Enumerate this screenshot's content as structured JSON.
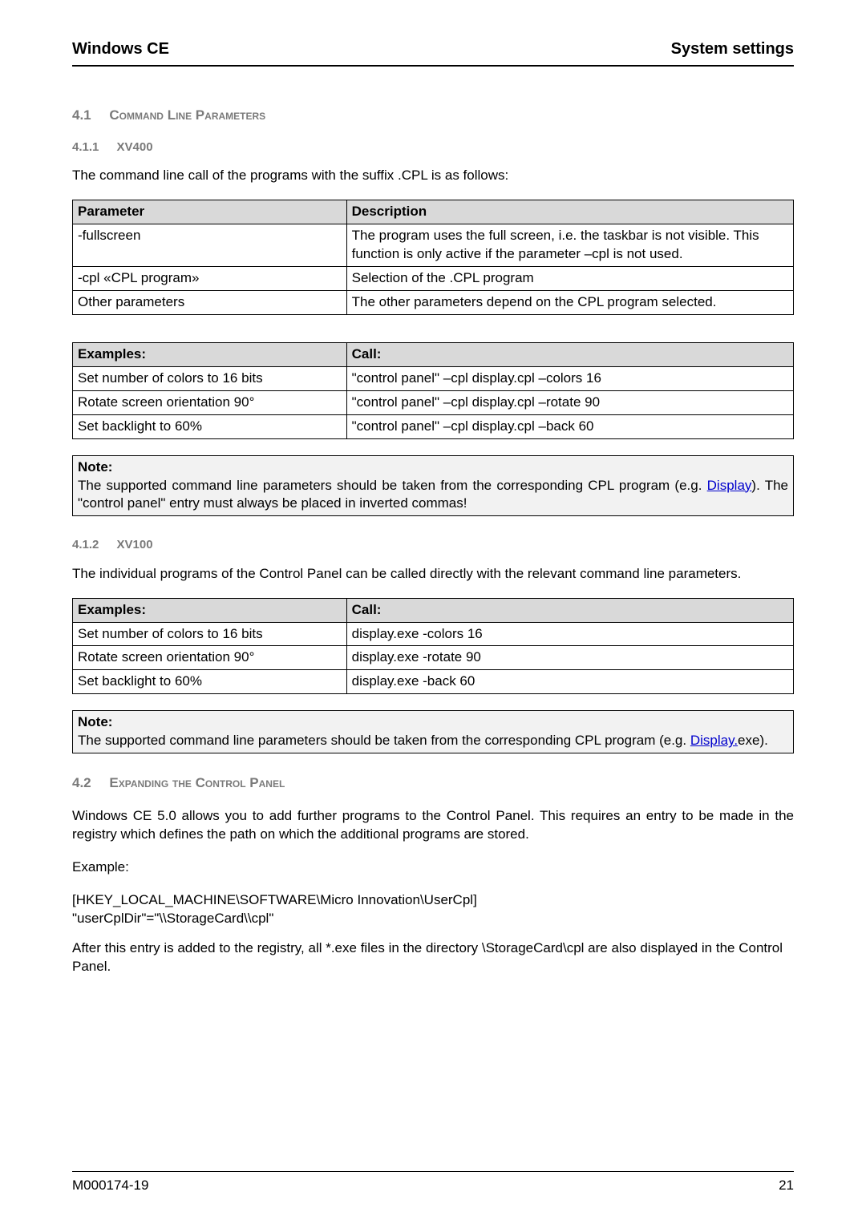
{
  "header": {
    "left": "Windows CE",
    "right": "System settings"
  },
  "sec41": {
    "num": "4.1",
    "title": "Command Line Parameters"
  },
  "sec411": {
    "num": "4.1.1",
    "title": "XV400",
    "intro": "The command line call of the programs with the suffix .CPL is as follows:"
  },
  "table1": {
    "headers": [
      "Parameter",
      "Description"
    ],
    "rows": [
      {
        "c0": "-fullscreen",
        "c1": "The program uses the full screen, i.e. the taskbar is not visible. This function is only active if the parameter –cpl is not used."
      },
      {
        "c0": "-cpl «CPL program»",
        "c1": "Selection of the .CPL program"
      },
      {
        "c0": "Other parameters",
        "c1": "The other parameters depend on the CPL program selected."
      }
    ]
  },
  "table2": {
    "headers": [
      "Examples:",
      "Call:"
    ],
    "rows": [
      {
        "c0": "Set number of colors to 16 bits",
        "c1": "\"control panel\" –cpl display.cpl –colors 16"
      },
      {
        "c0": "Rotate screen orientation 90°",
        "c1": "\"control panel\" –cpl display.cpl –rotate 90"
      },
      {
        "c0": "Set backlight to 60%",
        "c1": "\"control panel\" –cpl display.cpl –back 60"
      }
    ]
  },
  "note1": {
    "label": "Note:",
    "pre": "The supported command line parameters should be taken from the corresponding CPL program (e.g. ",
    "link": "Display",
    "post": "). The \"control panel\" entry must always be placed in inverted commas!"
  },
  "sec412": {
    "num": "4.1.2",
    "title": "XV100",
    "intro": "The individual programs of the Control Panel can be called directly with the relevant command line parameters."
  },
  "table3": {
    "headers": [
      "Examples:",
      "Call:"
    ],
    "rows": [
      {
        "c0": "Set number of colors to 16 bits",
        "c1": "display.exe -colors 16"
      },
      {
        "c0": "Rotate screen orientation 90°",
        "c1": "display.exe -rotate 90"
      },
      {
        "c0": "Set backlight to 60%",
        "c1": "display.exe -back 60"
      }
    ]
  },
  "note2": {
    "label": "Note:",
    "pre": "The supported command line parameters should be taken from the corresponding CPL program (e.g. ",
    "link": "Display.",
    "post": "exe)."
  },
  "sec42": {
    "num": "4.2",
    "title": "Expanding the Control Panel",
    "p1": "Windows CE 5.0 allows you to add further programs to the Control Panel. This requires an entry to be made in the registry which defines the path on which the additional programs are stored.",
    "exampleLabel": "Example:",
    "code1": "[HKEY_LOCAL_MACHINE\\SOFTWARE\\Micro Innovation\\UserCpl]",
    "code2": "\"userCplDir\"=\"\\\\StorageCard\\\\cpl\"",
    "p2": "After this entry is added to the registry, all *.exe files in the directory \\StorageCard\\cpl are also displayed in the Control Panel."
  },
  "footer": {
    "left": "M000174-19",
    "right": "21"
  }
}
